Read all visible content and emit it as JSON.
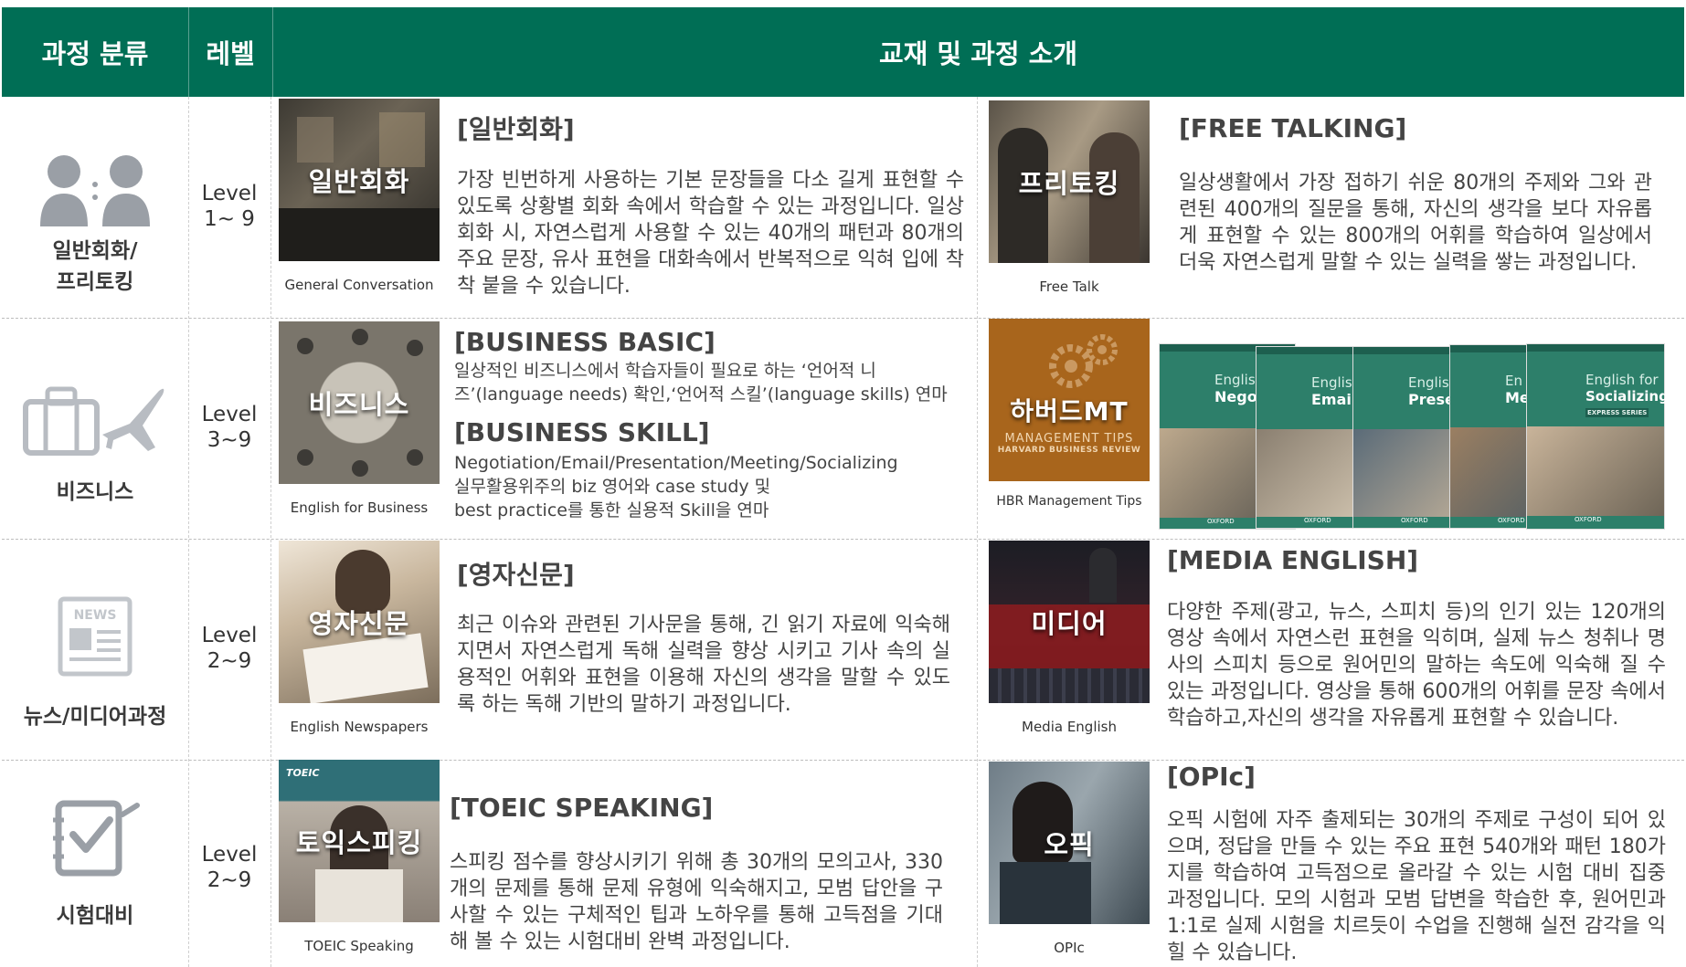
{
  "header": {
    "category": "과정 분류",
    "level": "레벨",
    "intro": "교재 및 과정 소개"
  },
  "rows": [
    {
      "category": "일반회화/\n프리토킹",
      "level": "Level\n1~ 9",
      "left": {
        "thumb_text": "일반회화",
        "caption": "General Conversation",
        "title": "[일반회화]",
        "body": "가장 빈번하게 사용하는 기본 문장들을 다소 길게 표현할 수 있도록 상황별 회화 속에서 학습할 수 있는 과정입니다. 일상 회화 시, 자연스럽게 사용할 수 있는 40개의 패턴과 80개의 주요 문장, 유사 표현을 대화속에서 반복적으로 익혀 입에 착착 붙을 수 있습니다."
      },
      "right": {
        "thumb_text": "프리토킹",
        "caption": "Free Talk",
        "title": "[FREE TALKING]",
        "body": "일상생활에서 가장 접하기 쉬운 80개의 주제와 그와 관련된 400개의 질문을 통해, 자신의 생각을 보다 자유롭게 표현할 수 있는 800개의 어휘를 학습하여 일상에서 더욱 자연스럽게 말할 수 있는 실력을 쌓는 과정입니다."
      }
    },
    {
      "category": "비즈니스",
      "level": "Level\n3~9",
      "left": {
        "thumb_text": "비즈니스",
        "caption": "English for Business",
        "title": "[BUSINESS BASIC]",
        "body": "일상적인 비즈니스에서 학습자들이 필요로 하는 ‘언어적 니즈’(language needs) 확인,‘언어적 스킬’(language skills) 연마",
        "title2": "[BUSINESS SKILL]",
        "body2_line1": "Negotiation/Email/Presentation/Meeting/Socializing",
        "body2_line2": "실무활용위주의 biz 영어와 case study 및",
        "body2_line3": "best practice를 통한 실용적 Skill을 연마"
      },
      "right": {
        "thumb_text": "하버드MT",
        "thumb_sub1": "MANAGEMENT TIPS",
        "thumb_sub2": "HARVARD BUSINESS REVIEW",
        "caption": "HBR Management Tips",
        "books": [
          {
            "label1": "English",
            "label2": "Negoti"
          },
          {
            "label1": "English",
            "label2": "Emails"
          },
          {
            "label1": "Englis",
            "label2": "Presen"
          },
          {
            "label1": "En",
            "label2": "Me"
          },
          {
            "label1": "English for",
            "label2": "Socializing"
          }
        ],
        "book_brand": "OXFORD",
        "book_series": "EXPRESS SERIES"
      }
    },
    {
      "category": "뉴스/미디어과정",
      "level": "Level\n2~9",
      "left": {
        "thumb_text": "영자신문",
        "caption": "English Newspapers",
        "title": "[영자신문]",
        "body": "최근 이슈와 관련된 기사문을 통해, 긴 읽기 자료에 익숙해지면서 자연스럽게 독해 실력을 향상 시키고 기사 속의 실용적인 어휘와 표현을 이용해 자신의 생각을 말할 수 있도록 하는 독해 기반의 말하기 과정입니다."
      },
      "right": {
        "thumb_text": "미디어",
        "caption": "Media English",
        "title": "[MEDIA ENGLISH]",
        "body": "다양한 주제(광고, 뉴스, 스피치 등)의 인기 있는 120개의 영상 속에서 자연스런 표현을 익히며, 실제 뉴스 청취나 명사의 스피치 등으로 원어민의 말하는 속도에 익숙해 질 수 있는 과정입니다. 영상을 통해 600개의 어휘를 문장 속에서 학습하고,자신의 생각을 자유롭게 표현할 수 있습니다."
      }
    },
    {
      "category": "시험대비",
      "level": "Level\n2~9",
      "left": {
        "thumb_text": "토익스피킹",
        "thumb_top": "TOEIC",
        "caption": "TOEIC Speaking",
        "title": "[TOEIC SPEAKING]",
        "body": "스피킹 점수를 향상시키기 위해 총 30개의 모의고사, 330개의 문제를 통해 문제 유형에 익숙해지고, 모범 답안을 구사할 수 있는 구체적인 팁과 노하우를 통해 고득점을 기대해 볼 수 있는 시험대비 완벽 과정입니다."
      },
      "right": {
        "thumb_text": "오픽",
        "caption": "OPIc",
        "title": "[OPIc]",
        "body": "오픽 시험에 자주 출제되는 30개의 주제로 구성이 되어 있으며, 정답을 만들 수 있는 주요 표현 540개와 패턴 180가지를 학습하여 고득점으로 올라갈 수 있는 시험 대비 집중 과정입니다. 모의 시험과 모범 답변을 학습한 후, 원어민과 1:1로 실제 시험을 치르듯이 수업을 진행해 실전 감각을 익힐 수 있습니다."
      }
    }
  ],
  "colors": {
    "header_bg": "#006e55",
    "icon_gray": "#9a9fa6"
  }
}
